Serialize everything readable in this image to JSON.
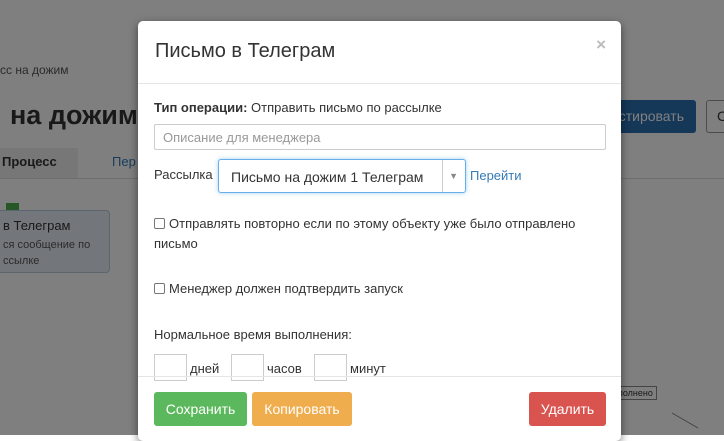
{
  "background": {
    "breadcrumb": "сс на дожим",
    "title": "на дожим",
    "primary_button": "стировать",
    "secondary_button": "С",
    "tabs": [
      {
        "label": "Процесс"
      },
      {
        "label": "Пер"
      }
    ],
    "node": {
      "title": "в Телеграм",
      "text": "ся сообщение по ссылке"
    },
    "node_label": "полнено"
  },
  "modal": {
    "title": "Письмо в Телеграм",
    "close": "×",
    "operation_type_label": "Тип операции:",
    "operation_type_value": "Отправить письмо по рассылке",
    "description_placeholder": "Описание для менеджера",
    "mailing_label": "Рассылка",
    "mailing_selected": "Письмо на дожим 1 Телеграм",
    "goto_link": "Перейти",
    "resend_label": "Отправлять повторно если по этому объекту уже было отправлено письмо",
    "confirm_label": "Менеджер должен подтвердить запуск",
    "normal_time_label": "Нормальное время выполнения:",
    "time_units": {
      "days": "дней",
      "hours": "часов",
      "minutes": "минут"
    },
    "buttons": {
      "save": "Сохранить",
      "copy": "Копировать",
      "delete": "Удалить"
    }
  }
}
